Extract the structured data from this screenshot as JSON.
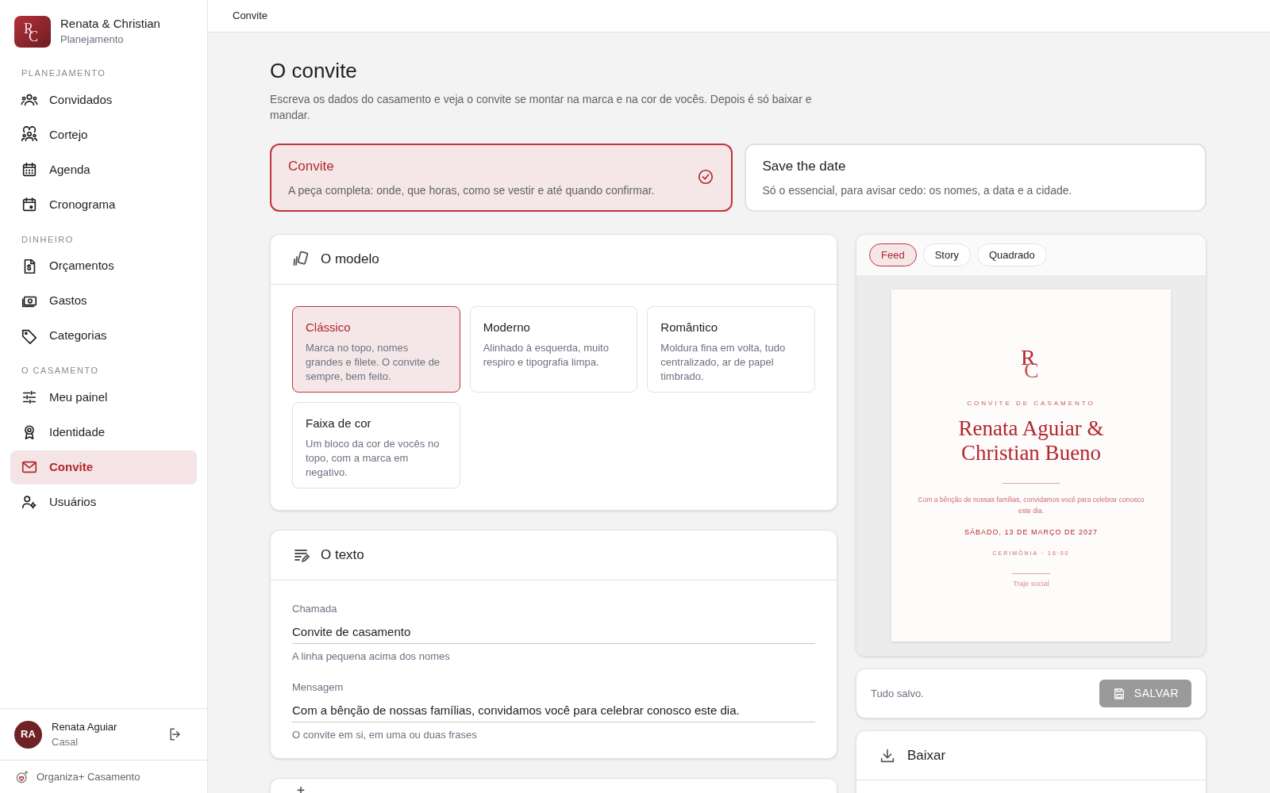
{
  "brand": {
    "initials": "RC",
    "title": "Renata & Christian",
    "subtitle": "Planejamento"
  },
  "sidebar": {
    "sections": [
      {
        "heading": "PLANEJAMENTO",
        "items": [
          {
            "label": "Convidados",
            "selected": false
          },
          {
            "label": "Cortejo",
            "selected": false
          },
          {
            "label": "Agenda",
            "selected": false
          },
          {
            "label": "Cronograma",
            "selected": false
          }
        ]
      },
      {
        "heading": "DINHEIRO",
        "items": [
          {
            "label": "Orçamentos",
            "selected": false
          },
          {
            "label": "Gastos",
            "selected": false
          },
          {
            "label": "Categorias",
            "selected": false
          }
        ]
      },
      {
        "heading": "O CASAMENTO",
        "items": [
          {
            "label": "Meu painel",
            "selected": false
          },
          {
            "label": "Identidade",
            "selected": false
          },
          {
            "label": "Convite",
            "selected": true
          },
          {
            "label": "Usuários",
            "selected": false
          }
        ]
      }
    ],
    "user": {
      "initials": "RA",
      "name": "Renata Aguiar",
      "role": "Casal"
    },
    "footer": "Organiza+ Casamento"
  },
  "breadcrumb": "Convite",
  "page": {
    "title": "O convite",
    "description": "Escreva os dados do casamento e veja o convite se montar na marca e na cor de vocês. Depois é só baixar e mandar."
  },
  "types": [
    {
      "title": "Convite",
      "description": "A peça completa: onde, que horas, como se vestir e até quando confirmar.",
      "selected": true
    },
    {
      "title": "Save the date",
      "description": "Só o essencial, para avisar cedo: os nomes, a data e a cidade.",
      "selected": false
    }
  ],
  "model_card": {
    "title": "O modelo",
    "options": [
      {
        "title": "Clássico",
        "description": "Marca no topo, nomes grandes e filete. O convite de sempre, bem feito.",
        "selected": true
      },
      {
        "title": "Moderno",
        "description": "Alinhado à esquerda, muito respiro e tipografia limpa.",
        "selected": false
      },
      {
        "title": "Romântico",
        "description": "Moldura fina em volta, tudo centralizado, ar de papel timbrado.",
        "selected": false
      },
      {
        "title": "Faixa de cor",
        "description": "Um bloco da cor de vocês no topo, com a marca em negativo.",
        "selected": false
      }
    ]
  },
  "text_card": {
    "title": "O texto",
    "fields": [
      {
        "label": "Chamada",
        "value": "Convite de casamento",
        "help": "A linha pequena acima dos nomes"
      },
      {
        "label": "Mensagem",
        "value": "Com a bênção de nossas famílias, convidamos você para celebrar conosco este dia.",
        "help": "O convite em si, em uma ou duas frases"
      }
    ]
  },
  "preview": {
    "formats": [
      {
        "label": "Feed",
        "selected": true
      },
      {
        "label": "Story",
        "selected": false
      },
      {
        "label": "Quadrado",
        "selected": false
      }
    ],
    "invite": {
      "monogram_top": "R",
      "monogram_bottom": "C",
      "kicker": "CONVITE DE CASAMENTO",
      "names": "Renata Aguiar & Christian Bueno",
      "message": "Com a bênção de nossas famílias, convidamos você para celebrar conosco este dia.",
      "date": "SÁBADO, 13 DE MARÇO DE 2027",
      "ceremony": "CERIMÔNIA · 16:00",
      "dress_code": "Traje social"
    }
  },
  "save": {
    "status": "Tudo salvo.",
    "button": "SALVAR",
    "disabled": true
  },
  "download": {
    "title": "Baixar"
  }
}
